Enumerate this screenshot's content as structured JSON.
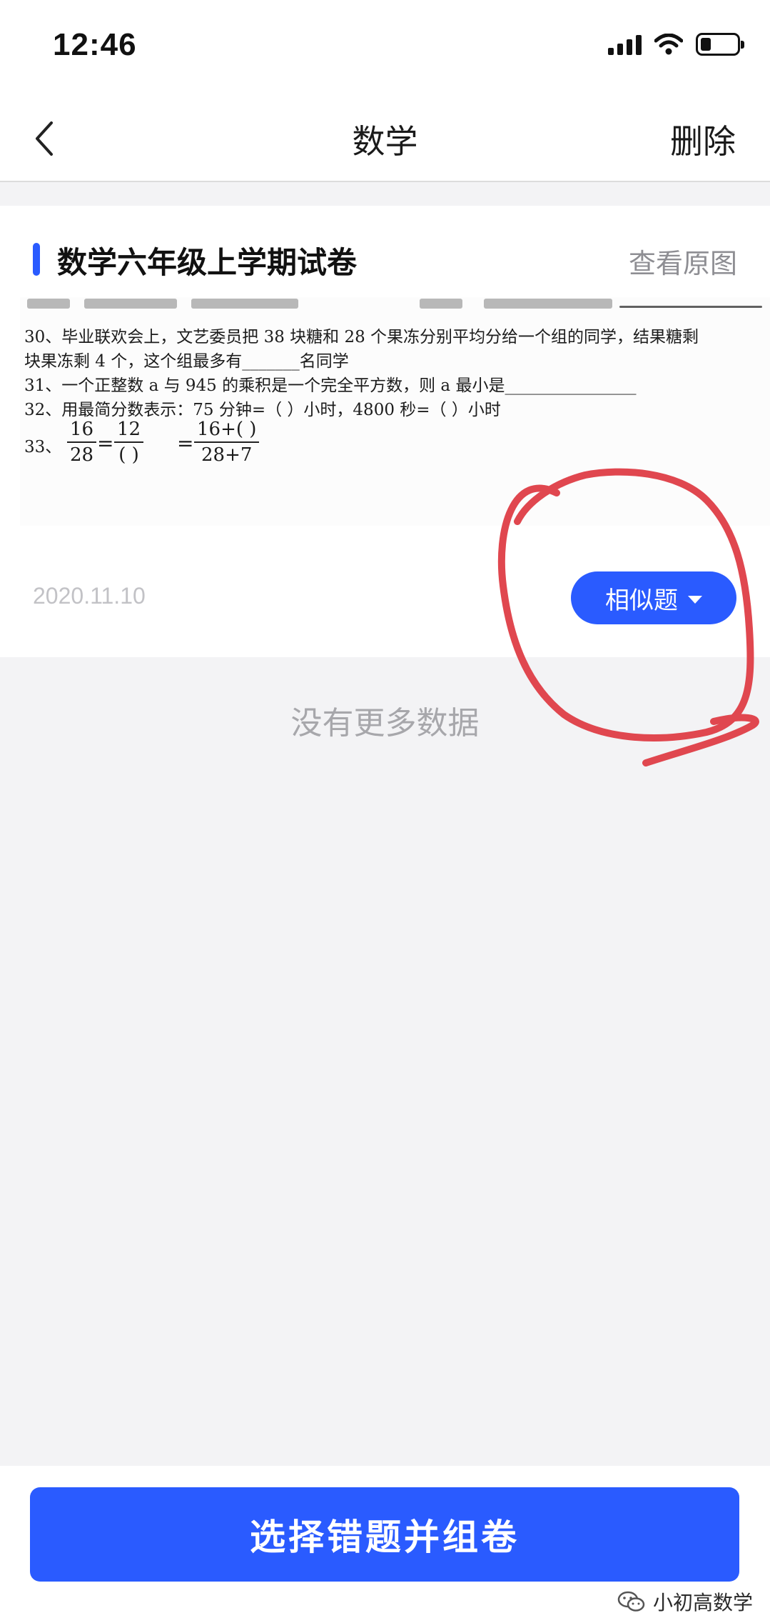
{
  "status_bar": {
    "time": "12:46",
    "icons": [
      "signal-icon",
      "wifi-icon",
      "battery-icon"
    ]
  },
  "nav": {
    "back_icon": "chevron-left-icon",
    "title": "数学",
    "delete_label": "删除"
  },
  "card": {
    "title": "数学六年级上学期试卷",
    "view_original_label": "查看原图",
    "date": "2020.11.10",
    "similar_button_label": "相似题",
    "similar_button_icon": "caret-down-icon",
    "exam_image": {
      "line_30a": "30、毕业联欢会上，文艺委员把 38 块糖和 28 个果冻分别平均分给一个组的同学，结果糖剩",
      "line_30b": "块果冻剩 4 个，这个组最多有_______名同学",
      "line_31": "31、一个正整数 a 与 945 的乘积是一个完全平方数，则 a 最小是________________",
      "line_32": "32、用最简分数表示：75 分钟=（        ）小时，4800 秒=（        ）小时",
      "line_33_label": "33、",
      "frac1_num": "16",
      "frac1_den": "28",
      "eq1": "=",
      "frac2_num": "12",
      "frac2_den": "(      )",
      "eq2": "=",
      "frac3_num": "16+(      )",
      "frac3_den": "28+7"
    }
  },
  "list_footer": "没有更多数据",
  "bottom": {
    "primary_button_label": "选择错题并组卷",
    "watermark_text": "小初高数学",
    "watermark_icon": "wechat-icon"
  },
  "colors": {
    "accent": "#2a5bff",
    "annotation": "#e0474f",
    "background": "#f3f3f5"
  }
}
